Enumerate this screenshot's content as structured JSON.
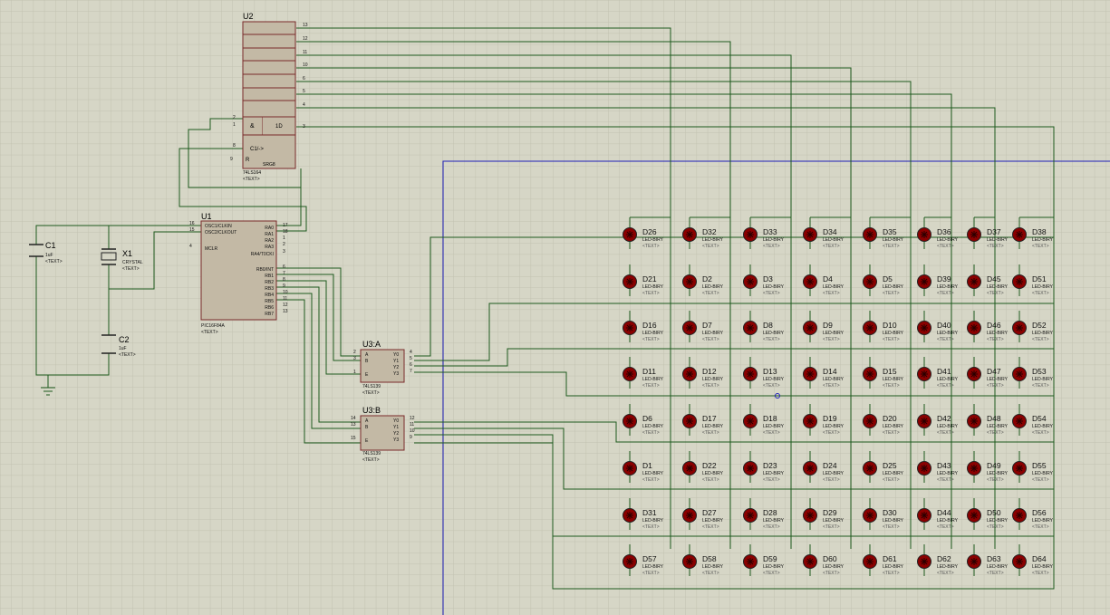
{
  "colors": {
    "background": "#d6d6c6",
    "grid": "#c2c2b0",
    "wire": "#1d5a1d",
    "part_fill": "#c3b9a5",
    "part_outline": "#7a2a2a",
    "led_fill": "#8a0000",
    "frame": "#1e1eb8"
  },
  "u2": {
    "ref": "U2",
    "model": "74LS164",
    "text": "<TEXT>",
    "pin_and": "&",
    "pin_1d": "1D",
    "pin_c1": "C1/->",
    "pin_r": "R",
    "srg": "SRG8",
    "pins_right": [
      "13",
      "12",
      "11",
      "10",
      "6",
      "5",
      "4",
      "3"
    ],
    "pins_left": [
      "2",
      "1",
      "8",
      "9"
    ]
  },
  "u1": {
    "ref": "U1",
    "model": "PIC16F84A",
    "text": "<TEXT>",
    "left_pins": [
      "OSC1/CLKIN",
      "OSC2/CLKOUT",
      "MCLR"
    ],
    "left_nums": [
      "16",
      "15",
      "4"
    ],
    "ra_pins": [
      "RA0",
      "RA1",
      "RA2",
      "RA3",
      "RA4/T0CKI"
    ],
    "ra_nums": [
      "17",
      "18",
      "1",
      "2",
      "3"
    ],
    "rb_pins": [
      "RB0/INT",
      "RB1",
      "RB2",
      "RB3",
      "RB4",
      "RB5",
      "RB6",
      "RB7"
    ],
    "rb_nums": [
      "6",
      "7",
      "8",
      "9",
      "10",
      "11",
      "12",
      "13"
    ]
  },
  "u3a": {
    "ref": "U3:A",
    "model": "74LS139",
    "text": "<TEXT>",
    "inputs": [
      "A",
      "B",
      "E"
    ],
    "input_nums": [
      "2",
      "3",
      "1"
    ],
    "outputs": [
      "Y0",
      "Y1",
      "Y2",
      "Y3"
    ],
    "output_nums": [
      "4",
      "5",
      "6",
      "7"
    ]
  },
  "u3b": {
    "ref": "U3:B",
    "model": "74LS139",
    "text": "<TEXT>",
    "inputs": [
      "A",
      "B",
      "E"
    ],
    "input_nums": [
      "14",
      "13",
      "15"
    ],
    "outputs": [
      "Y0",
      "Y1",
      "Y2",
      "Y3"
    ],
    "output_nums": [
      "12",
      "11",
      "10",
      "9"
    ]
  },
  "c1": {
    "ref": "C1",
    "value": "1uF",
    "text": "<TEXT>"
  },
  "c2": {
    "ref": "C2",
    "value": "1uF",
    "text": "<TEXT>"
  },
  "x1": {
    "ref": "X1",
    "value": "CRYSTAL",
    "text": "<TEXT>"
  },
  "leds": {
    "model": "LED-BIRY",
    "text": "<TEXT>",
    "grid": [
      [
        "D26",
        "D32",
        "D33",
        "D34",
        "D35",
        "D36",
        "D37",
        "D38"
      ],
      [
        "D21",
        "D2",
        "D3",
        "D4",
        "D5",
        "D39",
        "D45",
        "D51"
      ],
      [
        "D16",
        "D7",
        "D8",
        "D9",
        "D10",
        "D40",
        "D46",
        "D52"
      ],
      [
        "D11",
        "D12",
        "D13",
        "D14",
        "D15",
        "D41",
        "D47",
        "D53"
      ],
      [
        "D6",
        "D17",
        "D18",
        "D19",
        "D20",
        "D42",
        "D48",
        "D54"
      ],
      [
        "D1",
        "D22",
        "D23",
        "D24",
        "D25",
        "D43",
        "D49",
        "D55"
      ],
      [
        "D31",
        "D27",
        "D28",
        "D29",
        "D30",
        "D44",
        "D50",
        "D56"
      ],
      [
        "D57",
        "D58",
        "D59",
        "D60",
        "D61",
        "D62",
        "D63",
        "D64"
      ]
    ]
  }
}
